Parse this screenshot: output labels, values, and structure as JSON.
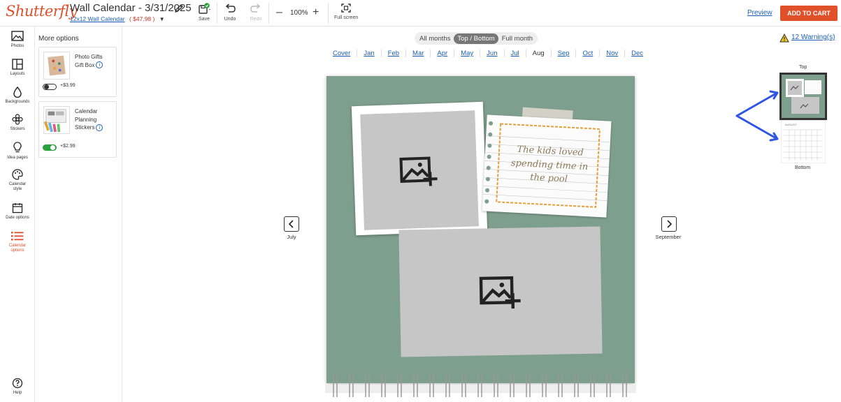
{
  "header": {
    "logo": "Shutterfly",
    "title": "Wall Calendar - 3/31/2025",
    "product_link": "12x12 Wall Calendar",
    "price": "( $47.98 )",
    "tools": {
      "save": "Save",
      "undo": "Undo",
      "redo": "Redo",
      "fullscreen": "Full screen"
    },
    "zoom": "100%",
    "preview": "Preview",
    "add_to_cart": "ADD TO CART"
  },
  "rail": {
    "photos": "Photos",
    "layouts": "Layouts",
    "backgrounds": "Backgrounds",
    "stickers": "Stickers",
    "idea_pages": "Idea pages",
    "calendar_style_1": "Calendar",
    "calendar_style_2": "style",
    "date_options": "Date options",
    "calendar_options_1": "Calendar",
    "calendar_options_2": "options",
    "help": "Help"
  },
  "panel": {
    "title": "More options",
    "options": [
      {
        "name_1": "Photo Gifts",
        "name_2": "Gift Box",
        "price": "+$3.99",
        "enabled": false
      },
      {
        "name_1": "Calendar",
        "name_2": "Planning",
        "name_3": "Stickers",
        "price": "+$2.99",
        "enabled": true
      }
    ]
  },
  "view_tabs": [
    "All months",
    "Top / Bottom",
    "Full month"
  ],
  "active_view": "Top / Bottom",
  "months": [
    "Cover",
    "Jan",
    "Feb",
    "Mar",
    "Apr",
    "May",
    "Jun",
    "Jul",
    "Aug",
    "Sep",
    "Oct",
    "Nov",
    "Dec"
  ],
  "active_month": "Aug",
  "warnings": "12 Warning(s)",
  "canvas": {
    "note_line_1": "The kids loved",
    "note_line_2": "spending time in",
    "note_line_3": "the pool",
    "prev_label": "July",
    "next_label": "September"
  },
  "thumbnails": {
    "top_label": "Top",
    "bottom_label": "Bottom",
    "bottom_month": "AUGUST"
  },
  "colors": {
    "brand": "#e0502b",
    "link": "#1a5fb4",
    "page_background": "#7f9f8e",
    "toggle_on": "#2aa13c",
    "annotation_arrow": "#2f54e8"
  }
}
